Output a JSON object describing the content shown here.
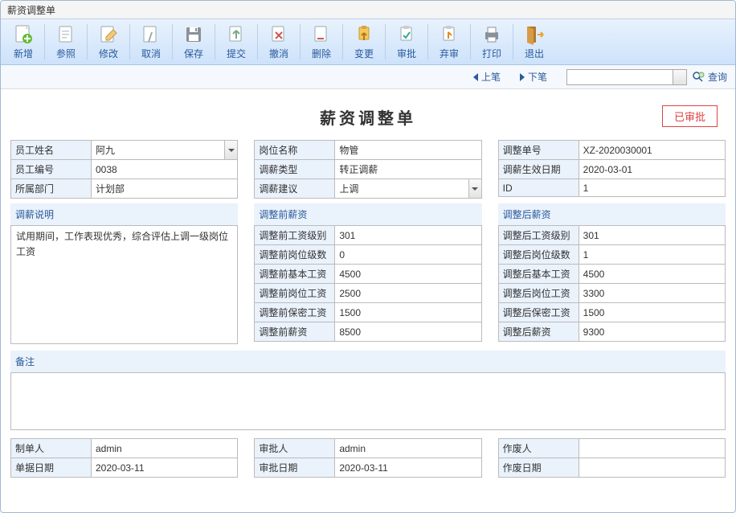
{
  "window": {
    "title": "薪资调整单"
  },
  "toolbar": {
    "new": "新增",
    "ref": "参照",
    "edit": "修改",
    "cancel": "取消",
    "save": "保存",
    "submit": "提交",
    "revoke": "撤消",
    "delete": "删除",
    "change": "变更",
    "approve": "审批",
    "reject": "弃审",
    "print": "打印",
    "exit": "退出"
  },
  "nav": {
    "prev": "上笔",
    "next": "下笔",
    "search": "查询"
  },
  "form": {
    "title": "薪资调整单",
    "status": "已审批"
  },
  "employee": {
    "name_label": "员工姓名",
    "name": "阿九",
    "code_label": "员工编号",
    "code": "0038",
    "dept_label": "所属部门",
    "dept": "计划部"
  },
  "position": {
    "post_label": "岗位名称",
    "post": "物管",
    "type_label": "调薪类型",
    "type": "转正调薪",
    "suggest_label": "调薪建议",
    "suggest": "上调"
  },
  "bill": {
    "no_label": "调整单号",
    "no": "XZ-2020030001",
    "date_label": "调薪生效日期",
    "date": "2020-03-01",
    "id_label": "ID",
    "id": "1"
  },
  "desc": {
    "header": "调薪说明",
    "text": "试用期间，工作表现优秀，综合评估上调一级岗位工资"
  },
  "before": {
    "header": "调整前薪资",
    "level_label": "调整前工资级别",
    "level": "301",
    "grade_label": "调整前岗位级数",
    "grade": "0",
    "base_label": "调整前基本工资",
    "base": "4500",
    "post_label": "调整前岗位工资",
    "post": "2500",
    "secret_label": "调整前保密工资",
    "secret": "1500",
    "total_label": "调整前薪资",
    "total": "8500"
  },
  "after": {
    "header": "调整后薪资",
    "level_label": "调整后工资级别",
    "level": "301",
    "grade_label": "调整后岗位级数",
    "grade": "1",
    "base_label": "调整后基本工资",
    "base": "4500",
    "post_label": "调整后岗位工资",
    "post": "3300",
    "secret_label": "调整后保密工资",
    "secret": "1500",
    "total_label": "调整后薪资",
    "total": "9300"
  },
  "remark": {
    "header": "备注",
    "text": ""
  },
  "footer": {
    "creator_label": "制单人",
    "creator": "admin",
    "bill_date_label": "单据日期",
    "bill_date": "2020-03-11",
    "approver_label": "审批人",
    "approver": "admin",
    "approve_date_label": "审批日期",
    "approve_date": "2020-03-11",
    "void_by_label": "作废人",
    "void_by": "",
    "void_date_label": "作废日期",
    "void_date": ""
  }
}
